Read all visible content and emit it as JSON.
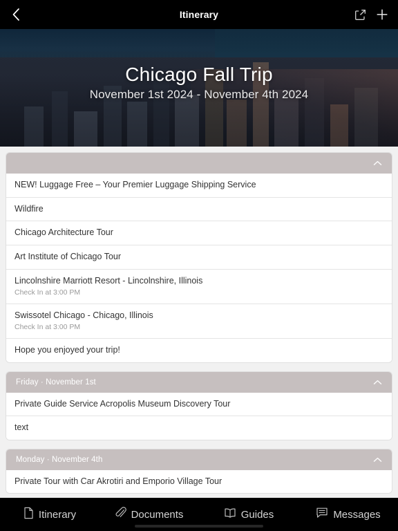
{
  "topbar": {
    "title": "Itinerary",
    "back_icon": "chevron-left-icon",
    "share_icon": "share-icon",
    "add_icon": "plus-icon"
  },
  "hero": {
    "trip_title": "Chicago Fall Trip",
    "trip_dates": "November 1st 2024 - November 4th 2024",
    "image_alt": "aerial-city-skyline-photo"
  },
  "sections": [
    {
      "label": "",
      "chevron": "chevron-up-icon",
      "rows": [
        {
          "title": "NEW! Luggage Free – Your Premier Luggage Shipping Service",
          "sub": ""
        },
        {
          "title": "Wildfire",
          "sub": ""
        },
        {
          "title": "Chicago Architecture Tour",
          "sub": ""
        },
        {
          "title": "Art Institute of Chicago Tour",
          "sub": ""
        },
        {
          "title": "Lincolnshire Marriott Resort - Lincolnshire, Illinois",
          "sub": "Check In at 3:00 PM"
        },
        {
          "title": "Swissotel Chicago - Chicago, Illinois",
          "sub": "Check In at 3:00 PM"
        },
        {
          "title": "Hope you enjoyed your trip!",
          "sub": ""
        }
      ]
    },
    {
      "label": "Friday · November 1st",
      "chevron": "chevron-up-icon",
      "rows": [
        {
          "title": "Private Guide Service Acropolis Museum Discovery Tour",
          "sub": ""
        },
        {
          "title": "text",
          "sub": ""
        }
      ]
    },
    {
      "label": "Monday · November 4th",
      "chevron": "chevron-up-icon",
      "rows": [
        {
          "title": "Private Tour with Car Akrotiri and Emporio Village Tour",
          "sub": ""
        }
      ]
    }
  ],
  "tabbar": {
    "tabs": [
      {
        "label": "Itinerary",
        "icon": "document-icon"
      },
      {
        "label": "Documents",
        "icon": "paperclip-icon"
      },
      {
        "label": "Guides",
        "icon": "open-book-icon"
      },
      {
        "label": "Messages",
        "icon": "message-bubble-icon"
      }
    ]
  },
  "colors": {
    "topbar_bg": "#000000",
    "page_bg": "#f1f1f1",
    "section_header_bg": "#c6bfbf",
    "row_text": "#333333",
    "row_subtext": "#9a9a9a",
    "tab_label": "#d4d4d4"
  }
}
